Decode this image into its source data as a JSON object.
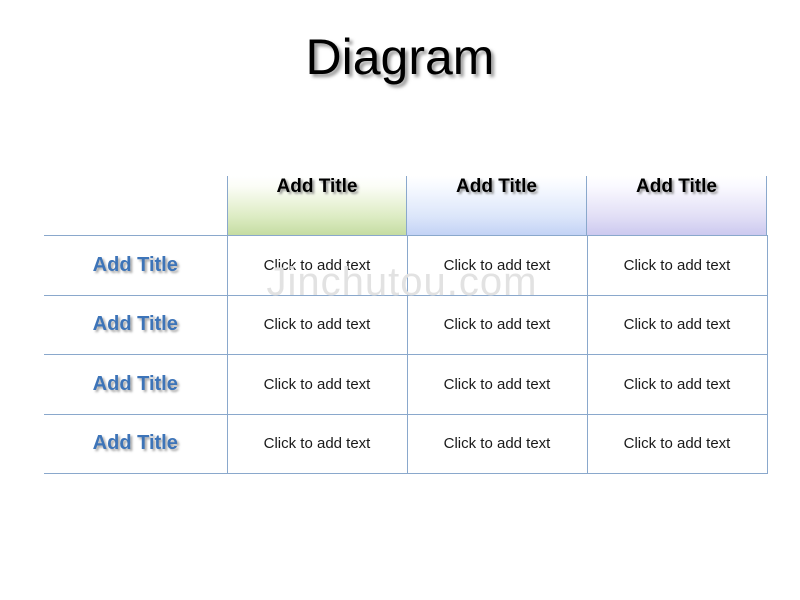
{
  "slide": {
    "title": "Diagram",
    "watermark": "Jinchutou.com"
  },
  "table": {
    "corner_label": "",
    "column_headers": [
      {
        "label": "Add Title",
        "accent": "#c5dca2"
      },
      {
        "label": "Add Title",
        "accent": "#c3d3f5"
      },
      {
        "label": "Add Title",
        "accent": "#ccc9ef"
      }
    ],
    "rows": [
      {
        "label": "Add Title",
        "cells": [
          "Click to add text",
          "Click to add text",
          "Click to add text"
        ]
      },
      {
        "label": "Add Title",
        "cells": [
          "Click to add text",
          "Click to add text",
          "Click to add text"
        ]
      },
      {
        "label": "Add Title",
        "cells": [
          "Click to add text",
          "Click to add text",
          "Click to add text"
        ]
      },
      {
        "label": "Add Title",
        "cells": [
          "Click to add text",
          "Click to add text",
          "Click to add text"
        ]
      }
    ],
    "border_color": "#8aa8cc",
    "row_label_color": "#3d74b8",
    "body_text_color": "#1a1a1a"
  }
}
